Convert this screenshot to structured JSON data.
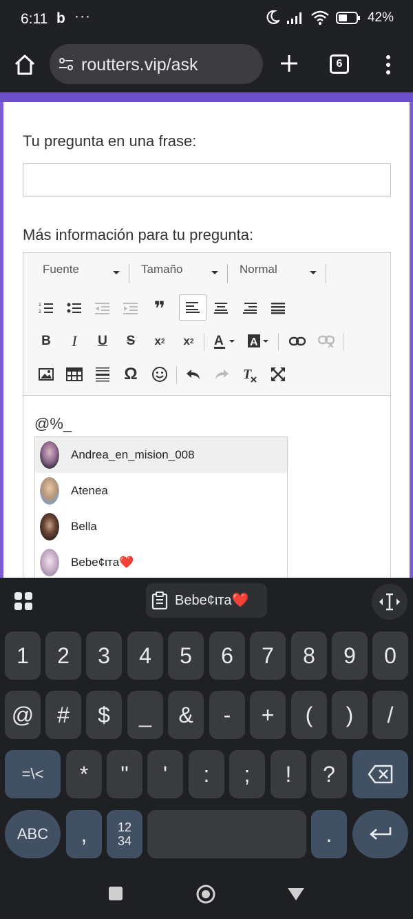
{
  "status_bar": {
    "time": "6:11",
    "app_icon": "b",
    "more": "···",
    "battery_pct": "42%",
    "icons": [
      "moon-icon",
      "signal-icon",
      "wifi-icon",
      "battery-icon"
    ]
  },
  "browser": {
    "url": "routters.vip/ask",
    "tab_count": "6",
    "icons": [
      "home-icon",
      "tune-icon",
      "plus-icon",
      "overflow-menu-icon"
    ]
  },
  "form": {
    "question_label": "Tu pregunta en una frase:",
    "question_value": "",
    "info_label": "Más información para tu pregunta:"
  },
  "editor": {
    "font_combo": "Fuente",
    "size_combo": "Tamaño",
    "format_combo": "Normal",
    "content": "@%_"
  },
  "mentions": [
    {
      "name": "Andrea_en_mision_008",
      "selected": true
    },
    {
      "name": "Atenea",
      "selected": false
    },
    {
      "name": "Bella",
      "selected": false
    },
    {
      "name": "Bеbе¢ιтa❤️",
      "selected": false
    }
  ],
  "keyboard": {
    "clipboard_chip": "Bеbе¢ιтa❤️",
    "row_numbers": [
      "1",
      "2",
      "3",
      "4",
      "5",
      "6",
      "7",
      "8",
      "9",
      "0"
    ],
    "row_symbols1": [
      "@",
      "#",
      "$",
      "_",
      "&",
      "-",
      "+",
      "(",
      ")",
      "/"
    ],
    "row_symbols2": [
      "=\\<",
      "*",
      "\"",
      "'",
      ":",
      ";",
      "!",
      "?"
    ],
    "abc_label": "ABC",
    "comma": ",",
    "numpad_label_top": "12",
    "numpad_label_bottom": "34",
    "period": "."
  },
  "colors": {
    "accent_purple": "#7d5bd7",
    "keyboard_bg": "#1f2023",
    "key_bg": "#3a3b3f",
    "action_key": "#415062"
  }
}
